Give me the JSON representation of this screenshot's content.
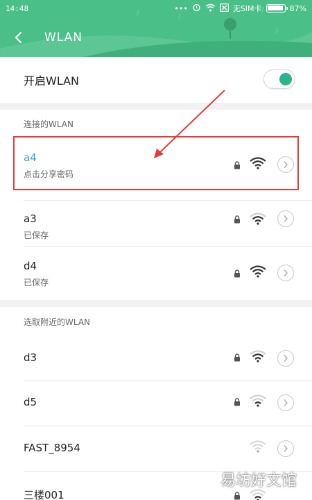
{
  "status_bar": {
    "time": "14:48",
    "icons": [
      "more-icon",
      "alarm-icon",
      "wifi-icon",
      "sim-icon"
    ],
    "sim_label": "无SIM卡",
    "battery": "87%"
  },
  "header": {
    "back_icon": "chevron-left-icon",
    "title": "WLAN"
  },
  "toggle": {
    "label": "开启WLAN",
    "on": true
  },
  "connected_section": {
    "label": "连接的WLAN",
    "networks": [
      {
        "ssid": "a4",
        "sub": "点击分享密码",
        "locked": true,
        "signal": "strong",
        "highlighted": true
      },
      {
        "ssid": "a3",
        "sub": "已保存",
        "locked": true,
        "signal": "medium"
      },
      {
        "ssid": "d4",
        "sub": "已保存",
        "locked": true,
        "signal": "strong"
      }
    ]
  },
  "nearby_section": {
    "label": "选取附近的WLAN",
    "networks": [
      {
        "ssid": "d3",
        "locked": true,
        "signal": "medium"
      },
      {
        "ssid": "d5",
        "locked": true,
        "signal": "weak"
      },
      {
        "ssid": "FAST_8954",
        "locked": false,
        "signal": "weak"
      },
      {
        "ssid": "三楼001",
        "locked": true,
        "signal": "weak"
      }
    ]
  },
  "colors": {
    "header_green": "#4bbf88",
    "accent_blue": "#3a9be0",
    "toggle_on": "#2bb58d",
    "annotation_red": "#e33b3b"
  },
  "watermark": "易坊好文馆"
}
